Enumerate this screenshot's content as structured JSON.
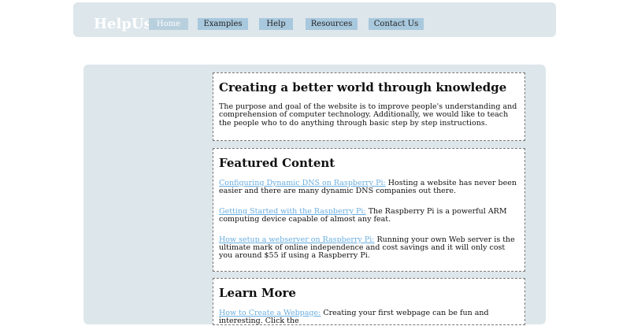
{
  "header": {
    "logo": "HelpUs",
    "nav": [
      {
        "label": "Home"
      },
      {
        "label": "Examples"
      },
      {
        "label": "Help"
      },
      {
        "label": "Resources"
      },
      {
        "label": "Contact Us"
      }
    ]
  },
  "mission": {
    "title": "Creating a better world through knowledge",
    "body": "The purpose and goal of the website is to improve people's understanding and comprehension of computer technology. Additionally, we would like to teach the people who to do anything through basic step by step instructions."
  },
  "featured": {
    "title": "Featured Content",
    "items": [
      {
        "link": "Configuring Dynamic DNS on Raspberry Pi:",
        "text": " Hosting a website has never been easier and there are many dynamic DNS companies out there."
      },
      {
        "link": "Getting Started with the Raspberry Pi:",
        "text": " The Raspberry Pi is a powerful ARM computing device capable of almost any feat."
      },
      {
        "link": "How setup a webserver on Raspberry Pi:",
        "text": " Running your own Web server is the ultimate mark of online independence and cost savings and it will only cost you around $55 if using a Raspberry Pi."
      }
    ]
  },
  "learn": {
    "title": "Learn More",
    "items": [
      {
        "link": "How to Create a Webpage:",
        "text": " Creating your first webpage can be fun and interesting. Click the"
      }
    ]
  },
  "colors": {
    "panel_bg": "#dde6eb",
    "nav_bg": "#a8c8dd",
    "link": "#6aaee0"
  }
}
